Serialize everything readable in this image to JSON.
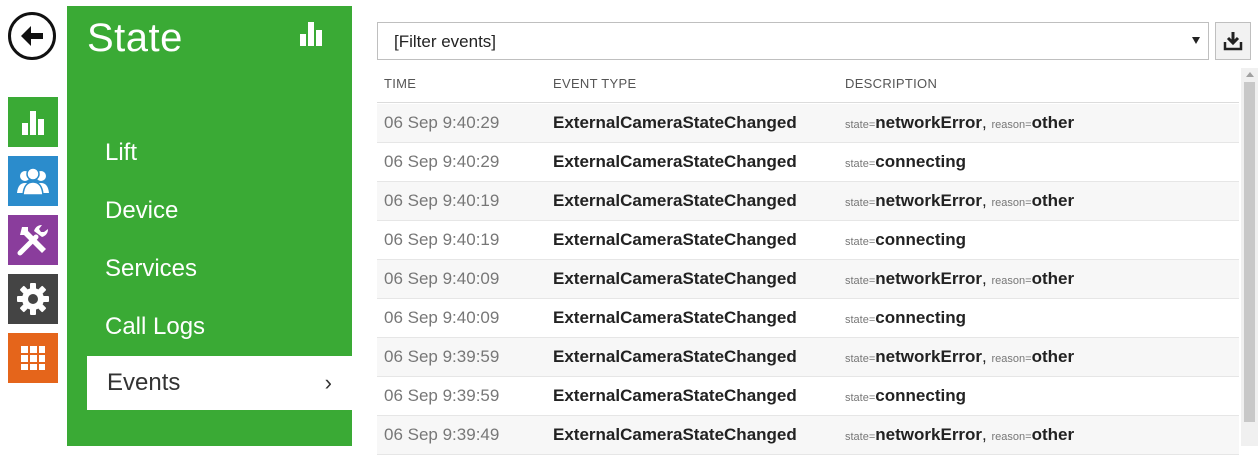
{
  "side": {
    "title": "State",
    "items": [
      {
        "label": "Lift"
      },
      {
        "label": "Device"
      },
      {
        "label": "Services"
      },
      {
        "label": "Call Logs"
      },
      {
        "label": "Events",
        "active": true,
        "chevron": "›"
      }
    ]
  },
  "rail": {
    "icons": [
      "back-arrow-icon",
      "bar-chart-icon",
      "users-icon",
      "tools-icon",
      "gear-icon",
      "grid-icon"
    ],
    "colors": {
      "state": "#3aaa35",
      "users": "#2b8ccc",
      "tools": "#8a3d9c",
      "settings": "#444444",
      "apps": "#e5651b"
    }
  },
  "filter": {
    "value": "[Filter events]"
  },
  "table": {
    "headers": {
      "time": "TIME",
      "type": "EVENT TYPE",
      "description": "DESCRIPTION"
    },
    "rows": [
      {
        "time": "06 Sep 9:40:29",
        "type": "ExternalCameraStateChanged",
        "state": "networkError",
        "reason": "other"
      },
      {
        "time": "06 Sep 9:40:29",
        "type": "ExternalCameraStateChanged",
        "state": "connecting"
      },
      {
        "time": "06 Sep 9:40:19",
        "type": "ExternalCameraStateChanged",
        "state": "networkError",
        "reason": "other"
      },
      {
        "time": "06 Sep 9:40:19",
        "type": "ExternalCameraStateChanged",
        "state": "connecting"
      },
      {
        "time": "06 Sep 9:40:09",
        "type": "ExternalCameraStateChanged",
        "state": "networkError",
        "reason": "other"
      },
      {
        "time": "06 Sep 9:40:09",
        "type": "ExternalCameraStateChanged",
        "state": "connecting"
      },
      {
        "time": "06 Sep 9:39:59",
        "type": "ExternalCameraStateChanged",
        "state": "networkError",
        "reason": "other"
      },
      {
        "time": "06 Sep 9:39:59",
        "type": "ExternalCameraStateChanged",
        "state": "connecting"
      },
      {
        "time": "06 Sep 9:39:49",
        "type": "ExternalCameraStateChanged",
        "state": "networkError",
        "reason": "other"
      }
    ],
    "labels": {
      "state_key": "state",
      "reason_key": "reason",
      "equals": "=",
      "comma": ","
    }
  }
}
